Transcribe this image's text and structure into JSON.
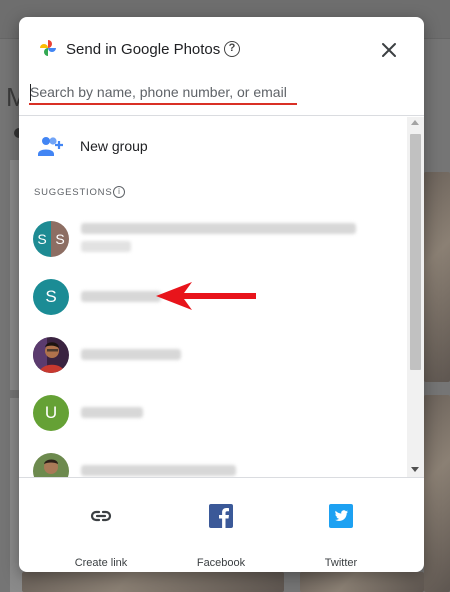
{
  "dialog": {
    "title": "Send in Google Photos",
    "help_icon": "help-circle-icon",
    "close_icon": "close-icon"
  },
  "search": {
    "placeholder": "Search by name, phone number, or email",
    "value": ""
  },
  "new_group": {
    "label": "New group",
    "icon": "group-add-icon"
  },
  "suggestions": {
    "heading": "SUGGESTIONS",
    "contacts": [
      {
        "avatar": "split",
        "initials": [
          "S",
          "S"
        ],
        "colors": [
          "#1e8b93",
          "#8d6e63"
        ]
      },
      {
        "avatar": "initial",
        "initial": "S",
        "color": "#1b8c95"
      },
      {
        "avatar": "photo"
      },
      {
        "avatar": "initial",
        "initial": "U",
        "color": "#65a135"
      },
      {
        "avatar": "photo"
      }
    ]
  },
  "share_options": [
    {
      "label": "Create link",
      "icon": "link-icon"
    },
    {
      "label": "Facebook",
      "icon": "facebook-icon",
      "color": "#3b5998"
    },
    {
      "label": "Twitter",
      "icon": "twitter-icon",
      "color": "#1da1f2"
    }
  ],
  "background": {
    "letter": "M"
  },
  "colors": {
    "search_underline": "#d93025",
    "annotation_arrow": "#e8141b"
  }
}
